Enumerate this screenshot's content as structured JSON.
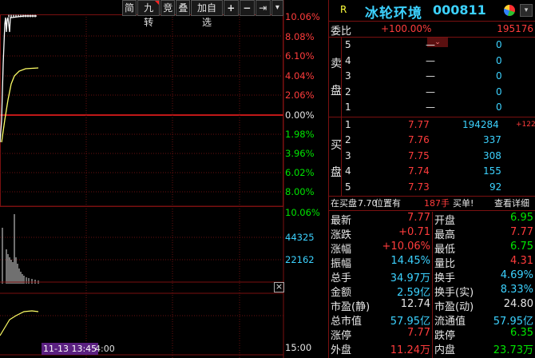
{
  "toolbar": {
    "buttons": [
      "简",
      "九转",
      "竞",
      "叠",
      "加自选",
      "+",
      "−",
      "⇥",
      "▾"
    ]
  },
  "chart": {
    "price_axis": [
      {
        "label": "10.06%",
        "color": "#ff3c3c"
      },
      {
        "label": "8.08%",
        "color": "#ff3c3c"
      },
      {
        "label": "6.10%",
        "color": "#ff3c3c"
      },
      {
        "label": "4.04%",
        "color": "#ff3c3c"
      },
      {
        "label": "2.06%",
        "color": "#ff3c3c"
      },
      {
        "label": "0.00%",
        "color": "#e6e6e6"
      },
      {
        "label": "1.98%",
        "color": "#00e600"
      },
      {
        "label": "3.96%",
        "color": "#00e600"
      },
      {
        "label": "6.02%",
        "color": "#00e600"
      },
      {
        "label": "8.00%",
        "color": "#00e600"
      }
    ],
    "volume_axis": [
      {
        "label": "10.06%",
        "color": "#00e600"
      },
      {
        "label": "44325",
        "color": "#3cd2ff"
      },
      {
        "label": "22162",
        "color": "#3cd2ff"
      }
    ],
    "time_label": "15:00",
    "cursor_time": "11-13 13:45",
    "cursor_time_suffix": "4:00",
    "close_icon": "×"
  },
  "stock": {
    "r_label": "R",
    "name": "冰轮环境",
    "code": "000811"
  },
  "ratio": {
    "label": "委比",
    "percent": "+100.00%",
    "diff": "195176"
  },
  "sell_side": {
    "label_top": "卖",
    "label_bottom": "盘",
    "rows": [
      {
        "level": "5",
        "price": "—",
        "vol": "0"
      },
      {
        "level": "4",
        "price": "—",
        "vol": "0"
      },
      {
        "level": "3",
        "price": "—",
        "vol": "0"
      },
      {
        "level": "2",
        "price": "—",
        "vol": "0"
      },
      {
        "level": "1",
        "price": "—",
        "vol": "0"
      }
    ]
  },
  "buy_side": {
    "label_top": "买",
    "label_bottom": "盘",
    "rows": [
      {
        "level": "1",
        "price": "7.77",
        "vol": "194284",
        "change": "+122"
      },
      {
        "level": "2",
        "price": "7.76",
        "vol": "337",
        "change": ""
      },
      {
        "level": "3",
        "price": "7.75",
        "vol": "308",
        "change": ""
      },
      {
        "level": "4",
        "price": "7.74",
        "vol": "155",
        "change": ""
      },
      {
        "level": "5",
        "price": "7.73",
        "vol": "92",
        "change": ""
      }
    ]
  },
  "notice": {
    "prefix": "在买盘",
    "price": "7.70",
    "middle": "位置有",
    "qty": "187手",
    "action": "买单!",
    "link": "查看详细"
  },
  "quote": {
    "rows": [
      {
        "l1": "最新",
        "v1": "7.77",
        "c1": "red",
        "l2": "开盘",
        "v2": "6.95",
        "c2": "green"
      },
      {
        "l1": "涨跌",
        "v1": "+0.71",
        "c1": "red",
        "l2": "最高",
        "v2": "7.77",
        "c2": "red"
      },
      {
        "l1": "涨幅",
        "v1": "+10.06%",
        "c1": "red",
        "l2": "最低",
        "v2": "6.75",
        "c2": "green"
      },
      {
        "l1": "振幅",
        "v1": "14.45%",
        "c1": "cyan",
        "l2": "量比",
        "v2": "4.31",
        "c2": "red"
      },
      {
        "l1": "总手",
        "v1": "34.97万",
        "c1": "cyan",
        "l2": "换手",
        "v2": "4.69%",
        "c2": "cyan"
      },
      {
        "l1": "金额",
        "v1": "2.59亿",
        "c1": "cyan",
        "l2": "换手(实)",
        "v2": "8.33%",
        "c2": "cyan"
      },
      {
        "l1": "市盈(静)",
        "v1": "12.74",
        "c1": "white",
        "l2": "市盈(动)",
        "v2": "24.80",
        "c2": "white"
      },
      {
        "l1": "总市值",
        "v1": "57.95亿",
        "c1": "cyan",
        "l2": "流通值",
        "v2": "57.95亿",
        "c2": "cyan"
      },
      {
        "l1": "涨停",
        "v1": "7.77",
        "c1": "red",
        "l2": "跌停",
        "v2": "6.35",
        "c2": "green"
      },
      {
        "l1": "外盘",
        "v1": "11.24万",
        "c1": "red",
        "l2": "内盘",
        "v2": "23.73万",
        "c2": "green"
      }
    ]
  }
}
